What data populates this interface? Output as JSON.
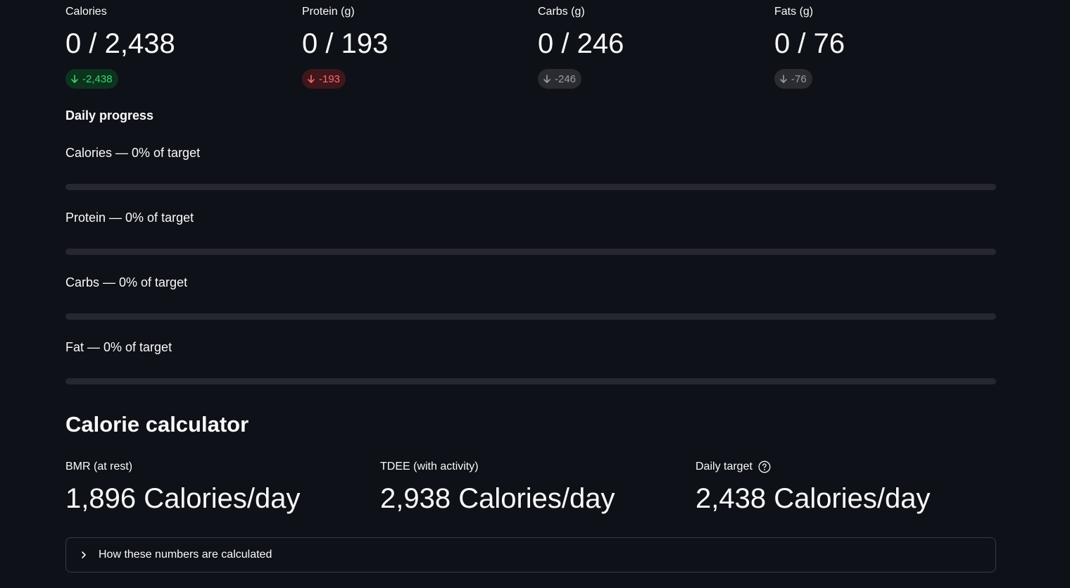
{
  "macros": [
    {
      "label": "Calories",
      "value": "0 / 2,438",
      "delta": "-2,438",
      "delta_color": "green"
    },
    {
      "label": "Protein (g)",
      "value": "0 / 193",
      "delta": "-193",
      "delta_color": "red"
    },
    {
      "label": "Carbs (g)",
      "value": "0 / 246",
      "delta": "-246",
      "delta_color": "gray"
    },
    {
      "label": "Fats (g)",
      "value": "0 / 76",
      "delta": "-76",
      "delta_color": "gray"
    }
  ],
  "progress": {
    "heading": "Daily progress",
    "items": [
      {
        "label": "Calories — 0% of target",
        "percent": 0
      },
      {
        "label": "Protein — 0% of target",
        "percent": 0
      },
      {
        "label": "Carbs — 0% of target",
        "percent": 0
      },
      {
        "label": "Fat — 0% of target",
        "percent": 0
      }
    ]
  },
  "calculator": {
    "title": "Calorie calculator",
    "metrics": [
      {
        "label": "BMR (at rest)",
        "value": "1,896 Calories/day"
      },
      {
        "label": "TDEE (with activity)",
        "value": "2,938 Calories/day"
      },
      {
        "label": "Daily target",
        "value": "2,438 Calories/day",
        "help_icon": "question-circle-icon"
      }
    ],
    "expander_label": "How these numbers are calculated",
    "expander_icon": "chevron-right-icon"
  },
  "icons": {
    "delta": "arrow-down-icon"
  },
  "colors": {
    "background": "#0e1117",
    "text": "#fafafa",
    "delta_green": "#3dd56d",
    "delta_red": "#ff6c6c",
    "delta_gray": "#9c9da3",
    "progress_track": "#262730"
  }
}
